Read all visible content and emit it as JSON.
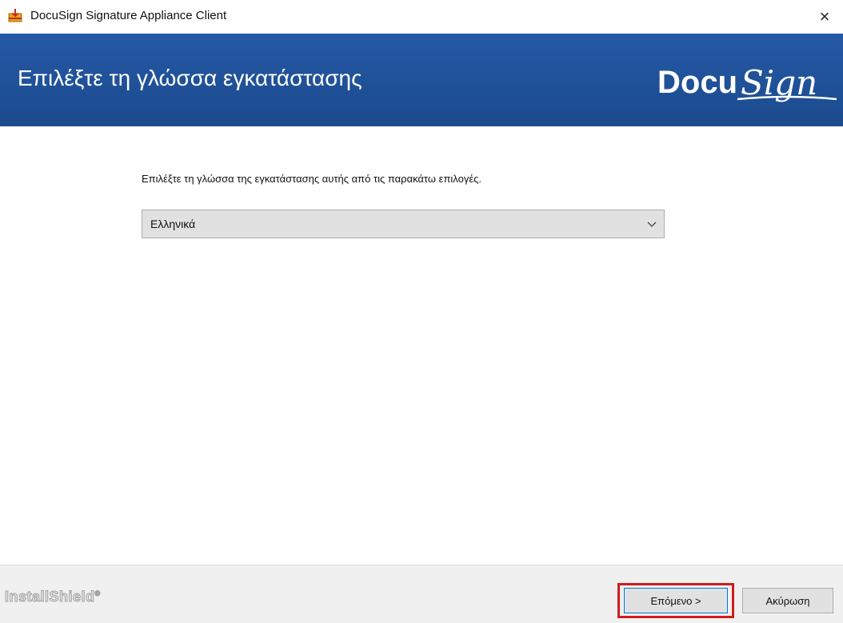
{
  "window": {
    "title": "DocuSign Signature Appliance Client",
    "close_glyph": "×",
    "icon": "installer-package-icon"
  },
  "banner": {
    "title": "Επιλέξτε τη γλώσσα εγκατάστασης",
    "logo": "DocuSign",
    "logo_part1": "Docu",
    "logo_part2": "Sign",
    "background": "#1f4e96"
  },
  "content": {
    "instruction": "Επιλέξτε τη γλώσσα της εγκατάστασης αυτής από τις παρακάτω επιλογές.",
    "language_select": {
      "selected": "Ελληνικά"
    }
  },
  "footer": {
    "brand": "InstallShield",
    "buttons": {
      "next": "Επόμενο >",
      "cancel": "Ακύρωση"
    },
    "highlight_color": "#d01c1c"
  }
}
